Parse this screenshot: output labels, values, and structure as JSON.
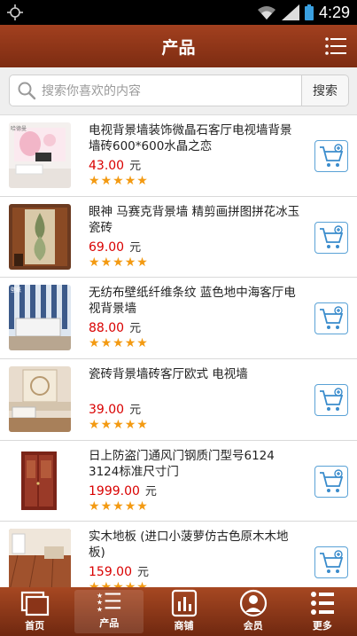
{
  "status_bar": {
    "time": "4:29"
  },
  "header": {
    "title": "产品",
    "menu_icon": "menu-list-icon"
  },
  "search": {
    "placeholder": "搜索你喜欢的内容",
    "button_label": "搜索"
  },
  "products": [
    {
      "name": "电视背景墙装饰微晶石客厅电视墙背景 墙砖600*600水晶之恋",
      "price": "43.00",
      "unit": "元",
      "rating": 5,
      "image": "tv-wall-tile-image"
    },
    {
      "name": "眼神 马赛克背景墙 精剪画拼图拼花冰玉瓷砖",
      "price": "69.00",
      "unit": "元",
      "rating": 5,
      "image": "mosaic-wall-image"
    },
    {
      "name": "无纺布壁纸纤维条纹 蓝色地中海客厅电视背景墙",
      "price": "88.00",
      "unit": "元",
      "rating": 5,
      "image": "striped-wallpaper-image"
    },
    {
      "name": "瓷砖背景墙砖客厅欧式 电视墙",
      "price": "39.00",
      "unit": "元",
      "rating": 5,
      "image": "european-tile-image"
    },
    {
      "name": "日上防盗门通风门钢质门型号6124 3124标准尺寸门",
      "price": "1999.00",
      "unit": "元",
      "rating": 5,
      "image": "security-door-image"
    },
    {
      "name": "实木地板 (进口小菠萝仿古色原木木地板)",
      "price": "159.00",
      "unit": "元",
      "rating": 5,
      "image": "wood-floor-image"
    }
  ],
  "tabs": [
    {
      "label": "首页",
      "icon": "home-icon"
    },
    {
      "label": "产品",
      "icon": "product-list-icon",
      "active": true
    },
    {
      "label": "商铺",
      "icon": "shop-chart-icon"
    },
    {
      "label": "会员",
      "icon": "member-icon"
    },
    {
      "label": "更多",
      "icon": "more-icon"
    }
  ],
  "colors": {
    "header": "#8f3619",
    "price": "#d90000",
    "star": "#f39a12",
    "cart_border": "#5aa2d6"
  }
}
